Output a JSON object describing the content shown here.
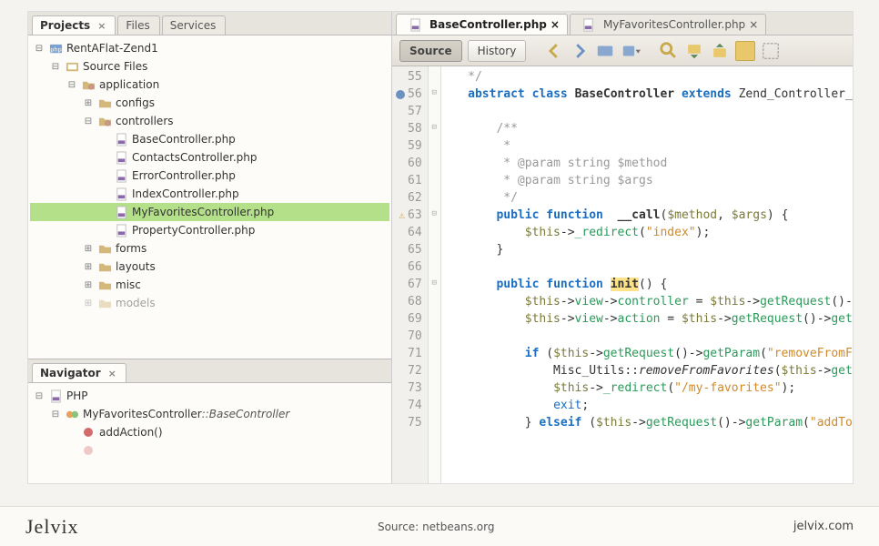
{
  "project_panel": {
    "tabs": [
      {
        "label": "Projects",
        "active": true,
        "closable": true
      },
      {
        "label": "Files",
        "active": false,
        "closable": false
      },
      {
        "label": "Services",
        "active": false,
        "closable": false
      }
    ],
    "tree": [
      {
        "depth": 0,
        "toggle": "-",
        "icon": "php-project",
        "label": "RentAFlat-Zend1",
        "sel": false
      },
      {
        "depth": 1,
        "toggle": "-",
        "icon": "source",
        "label": "Source Files",
        "sel": false
      },
      {
        "depth": 2,
        "toggle": "-",
        "icon": "folder-pkg",
        "label": "application",
        "sel": false
      },
      {
        "depth": 3,
        "toggle": "+",
        "icon": "folder",
        "label": "configs",
        "sel": false
      },
      {
        "depth": 3,
        "toggle": "-",
        "icon": "folder-pkg",
        "label": "controllers",
        "sel": false
      },
      {
        "depth": 4,
        "toggle": "",
        "icon": "php-file",
        "label": "BaseController.php",
        "sel": false
      },
      {
        "depth": 4,
        "toggle": "",
        "icon": "php-file",
        "label": "ContactsController.php",
        "sel": false
      },
      {
        "depth": 4,
        "toggle": "",
        "icon": "php-file",
        "label": "ErrorController.php",
        "sel": false
      },
      {
        "depth": 4,
        "toggle": "",
        "icon": "php-file",
        "label": "IndexController.php",
        "sel": false
      },
      {
        "depth": 4,
        "toggle": "",
        "icon": "php-file",
        "label": "MyFavoritesController.php",
        "sel": true
      },
      {
        "depth": 4,
        "toggle": "",
        "icon": "php-file",
        "label": "PropertyController.php",
        "sel": false
      },
      {
        "depth": 3,
        "toggle": "+",
        "icon": "folder",
        "label": "forms",
        "sel": false
      },
      {
        "depth": 3,
        "toggle": "+",
        "icon": "folder",
        "label": "layouts",
        "sel": false
      },
      {
        "depth": 3,
        "toggle": "+",
        "icon": "folder",
        "label": "misc",
        "sel": false
      },
      {
        "depth": 3,
        "toggle": "+",
        "icon": "folder",
        "label": "models",
        "sel": false,
        "cut": true
      }
    ]
  },
  "navigator_panel": {
    "title": "Navigator",
    "tree": [
      {
        "depth": 0,
        "toggle": "-",
        "icon": "php-file",
        "label": "PHP"
      },
      {
        "depth": 1,
        "toggle": "-",
        "icon": "class",
        "label": "MyFavoritesController",
        "suffix": "::BaseController"
      },
      {
        "depth": 2,
        "toggle": "",
        "icon": "method-pub",
        "label": "addAction()"
      },
      {
        "depth": 2,
        "toggle": "",
        "icon": "method-pub",
        "label": "",
        "cut": true
      }
    ]
  },
  "editor": {
    "tabs": [
      {
        "icon": "php-file",
        "label": "BaseController.php",
        "active": true
      },
      {
        "icon": "php-file",
        "label": "MyFavoritesController.php",
        "active": false
      }
    ],
    "toolbar": {
      "source": "Source",
      "history": "History"
    },
    "lines": [
      {
        "n": 55,
        "fold": "",
        "html": "   <span class='cm'>*/</span>"
      },
      {
        "n": 56,
        "badge": "info",
        "fold": "⊟",
        "html": "   <span class='kw'>abstract</span> <span class='kw'>class</span> <span class='cls'>BaseController</span> <span class='kw'>extends</span> <span class='type'>Zend_Controller_Ac</span>"
      },
      {
        "n": 57,
        "fold": "",
        "html": ""
      },
      {
        "n": 58,
        "fold": "⊟",
        "html": "       <span class='cm'>/**</span>"
      },
      {
        "n": 59,
        "fold": "",
        "html": "        <span class='cm'>*</span>"
      },
      {
        "n": 60,
        "fold": "",
        "html": "        <span class='cm'>* @param</span> <span class='cm'>string $method</span>"
      },
      {
        "n": 61,
        "fold": "",
        "html": "        <span class='cm'>* @param</span> <span class='cm'>string $args</span>"
      },
      {
        "n": 62,
        "fold": "",
        "html": "        <span class='cm'>*/</span>"
      },
      {
        "n": 63,
        "badge": "warn",
        "fold": "⊟",
        "html": "       <span class='kw'>public</span> <span class='kw'>function</span>  <span class='fn'>__call</span>(<span class='var'>$method</span>, <span class='var'>$args</span>) {"
      },
      {
        "n": 64,
        "fold": "",
        "html": "           <span class='var'>$this</span>-&gt;<span class='meth'>_redirect</span>(<span class='str'>\"index\"</span>);"
      },
      {
        "n": 65,
        "fold": "",
        "html": "       }"
      },
      {
        "n": 66,
        "fold": "",
        "html": ""
      },
      {
        "n": 67,
        "fold": "⊟",
        "html": "       <span class='kw'>public</span> <span class='kw'>function</span> <span class='fn hi'>init</span>() {"
      },
      {
        "n": 68,
        "fold": "",
        "html": "           <span class='var'>$this</span>-&gt;<span class='meth'>view</span>-&gt;<span class='meth'>controller</span> = <span class='var'>$this</span>-&gt;<span class='meth'>getRequest</span>()-&gt;<span class='meth'>g</span>"
      },
      {
        "n": 69,
        "fold": "",
        "html": "           <span class='var'>$this</span>-&gt;<span class='meth'>view</span>-&gt;<span class='meth'>action</span> = <span class='var'>$this</span>-&gt;<span class='meth'>getRequest</span>()-&gt;<span class='meth'>getAc</span>"
      },
      {
        "n": 70,
        "fold": "",
        "html": ""
      },
      {
        "n": 71,
        "fold": "",
        "html": "           <span class='kw'>if</span> (<span class='var'>$this</span>-&gt;<span class='meth'>getRequest</span>()-&gt;<span class='meth'>getParam</span>(<span class='str'>\"removeFromFav</span>"
      },
      {
        "n": 72,
        "fold": "",
        "html": "               Misc_Utils::<span style='font-style:italic'>removeFromFavorites</span>(<span class='var'>$this</span>-&gt;<span class='meth'>getRe</span>"
      },
      {
        "n": 73,
        "fold": "",
        "html": "               <span class='var'>$this</span>-&gt;<span class='meth'>_redirect</span>(<span class='str'>\"/my-favorites\"</span>);"
      },
      {
        "n": 74,
        "fold": "",
        "html": "               <span class='kw2'>exit</span>;"
      },
      {
        "n": 75,
        "fold": "",
        "html": "           } <span class='kw'>elseif</span> (<span class='var'>$this</span>-&gt;<span class='meth'>getRequest</span>()-&gt;<span class='meth'>getParam</span>(<span class='str'>\"addToFa</span>"
      }
    ]
  },
  "footer": {
    "brand": "Jelvix",
    "source_label": "Source:",
    "source_value": "netbeans.org",
    "url": "jelvix.com"
  }
}
